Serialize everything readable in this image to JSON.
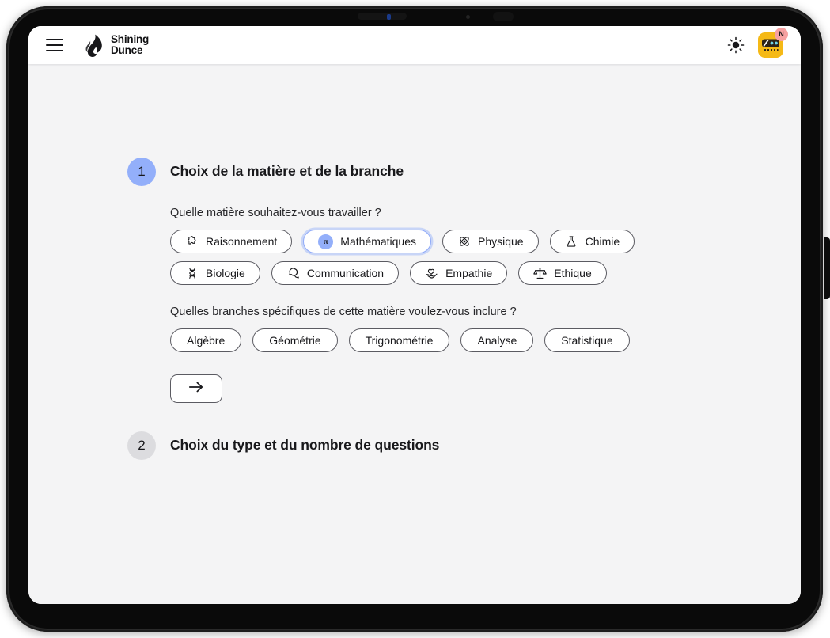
{
  "app": {
    "brand_line1": "Shining",
    "brand_line2": "Dunce",
    "menu_icon": "hamburger-menu-icon",
    "logo_icon": "flame-logo-icon",
    "theme_icon": "sun-icon",
    "avatar_icon": "robot-avatar-icon",
    "avatar_badge": "N"
  },
  "colors": {
    "active_step": "#93AFFA",
    "inactive_step": "#DCDCDF",
    "connector": "#9DB6FB",
    "selected_chip_border": "#8FAAF8",
    "avatar_yellow": "#F5B916",
    "badge_pink": "#F7A1A1",
    "screen_bg": "#f4f4f5",
    "header_bg": "#ffffff"
  },
  "steps": [
    {
      "number": "1",
      "title": "Choix de la matière et de la branche",
      "state": "active",
      "questions": [
        {
          "label": "Quelle matière souhaitez-vous travailler ?",
          "options": [
            {
              "label": "Raisonnement",
              "icon": "puzzle-piece-icon",
              "selected": false
            },
            {
              "label": "Mathématiques",
              "icon": "pi-icon",
              "selected": true
            },
            {
              "label": "Physique",
              "icon": "atom-icon",
              "selected": false
            },
            {
              "label": "Chimie",
              "icon": "flask-icon",
              "selected": false
            },
            {
              "label": "Biologie",
              "icon": "dna-icon",
              "selected": false
            },
            {
              "label": "Communication",
              "icon": "speech-bubbles-icon",
              "selected": false
            },
            {
              "label": "Empathie",
              "icon": "heart-hand-icon",
              "selected": false
            },
            {
              "label": "Ethique",
              "icon": "scales-icon",
              "selected": false
            }
          ]
        },
        {
          "label": "Quelles branches spécifiques de cette matière voulez-vous inclure ?",
          "options": [
            {
              "label": "Algèbre",
              "icon": "",
              "selected": false
            },
            {
              "label": "Géométrie",
              "icon": "",
              "selected": false
            },
            {
              "label": "Trigonométrie",
              "icon": "",
              "selected": false
            },
            {
              "label": "Analyse",
              "icon": "",
              "selected": false
            },
            {
              "label": "Statistique",
              "icon": "",
              "selected": false
            }
          ]
        }
      ],
      "next_button": {
        "icon": "arrow-right-icon",
        "label": ""
      }
    },
    {
      "number": "2",
      "title": "Choix du type et du nombre de questions",
      "state": "inactive",
      "questions": [],
      "next_button": null
    }
  ]
}
